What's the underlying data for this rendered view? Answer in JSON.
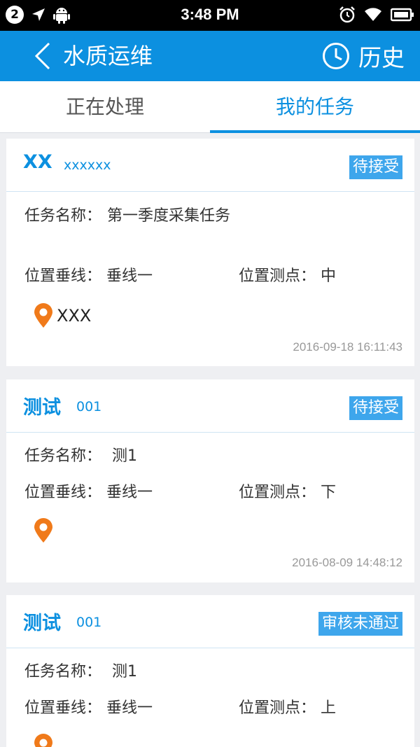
{
  "statusbar": {
    "notif_count": "2",
    "time": "3:48 PM"
  },
  "header": {
    "title": "水质运维",
    "history_label": "历史"
  },
  "tabs": [
    {
      "label": "正在处理"
    },
    {
      "label": "我的任务"
    }
  ],
  "labels": {
    "task_name": "任务名称：",
    "vertical": "位置垂线：",
    "point": "位置测点："
  },
  "cards": [
    {
      "name": "XX",
      "code": "xxxxxx",
      "status": "待接受",
      "task_name": "第一季度采集任务",
      "vertical": "垂线一",
      "point": "中",
      "location": "XXX",
      "date": "2016-09-18 16:11:43"
    },
    {
      "name": "测试",
      "code": "001",
      "status": "待接受",
      "task_name": "测1",
      "vertical": "垂线一",
      "point": "下",
      "location": "",
      "date": "2016-08-09 14:48:12"
    },
    {
      "name": "测试",
      "code": "001",
      "status": "审核未通过",
      "task_name": "测1",
      "vertical": "垂线一",
      "point": "上",
      "location": "",
      "date": ""
    }
  ],
  "colors": {
    "primary": "#0c90e0",
    "badge": "#3ea6ec",
    "pin": "#f07a1a"
  }
}
